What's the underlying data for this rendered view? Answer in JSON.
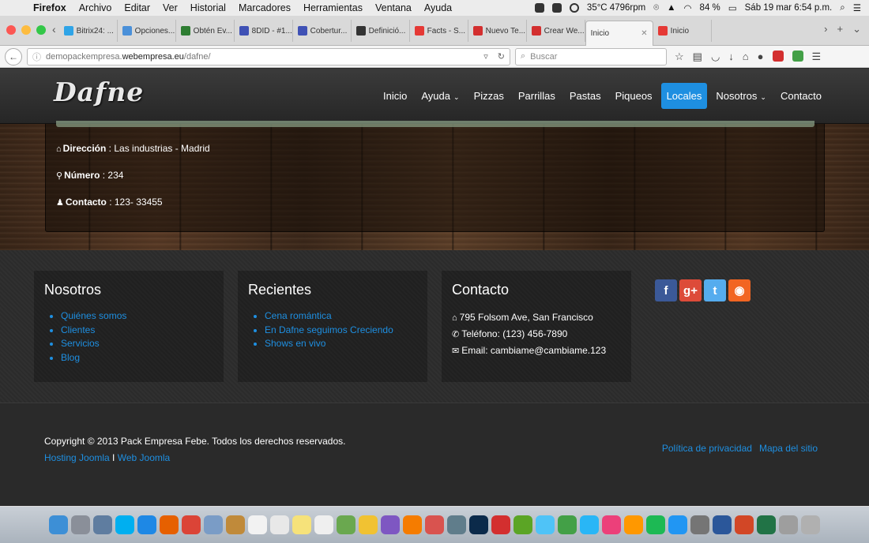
{
  "menubar": {
    "app": "Firefox",
    "items": [
      "Archivo",
      "Editar",
      "Ver",
      "Historial",
      "Marcadores",
      "Herramientas",
      "Ventana",
      "Ayuda"
    ],
    "temp": "35°C 4796rpm",
    "battery": "84 %",
    "datetime": "Sáb 19 mar  6:54 p.m."
  },
  "tabs": [
    {
      "label": "Bitrix24: ...",
      "color": "#2fa4e7"
    },
    {
      "label": "Opciones...",
      "color": "#4a90d9"
    },
    {
      "label": "Obtén Ev...",
      "color": "#2e7d32"
    },
    {
      "label": "8DID - #1...",
      "color": "#3f51b5"
    },
    {
      "label": "Cobertur...",
      "color": "#3f51b5"
    },
    {
      "label": "Definició...",
      "color": "#333333"
    },
    {
      "label": "Facts - S...",
      "color": "#e53935"
    },
    {
      "label": "Nuevo Te...",
      "color": "#d32f2f"
    },
    {
      "label": "Crear We...",
      "color": "#d32f2f"
    },
    {
      "label": "Inicio",
      "color": "#f5f5f5",
      "active": true
    },
    {
      "label": "Inicio",
      "color": "#e53935"
    }
  ],
  "navbar": {
    "url_prefix": "demopackempresa.",
    "url_host": "webempresa.eu",
    "url_path": "/dafne/",
    "search_placeholder": "Buscar"
  },
  "site": {
    "logo": "Dafne",
    "nav": [
      {
        "label": "Inicio"
      },
      {
        "label": "Ayuda",
        "caret": true
      },
      {
        "label": "Pizzas"
      },
      {
        "label": "Parrillas"
      },
      {
        "label": "Pastas"
      },
      {
        "label": "Piqueos"
      },
      {
        "label": "Locales",
        "active": true
      },
      {
        "label": "Nosotros",
        "caret": true
      },
      {
        "label": "Contacto"
      }
    ]
  },
  "location": {
    "address_label": "Dirección",
    "address_value": " : Las industrias - Madrid",
    "number_label": "Número",
    "number_value": " : 234",
    "contact_label": "Contacto",
    "contact_value": " : 123- 33455"
  },
  "footer": {
    "nosotros": {
      "title": "Nosotros",
      "links": [
        "Quiénes somos",
        "Clientes",
        "Servicios",
        "Blog"
      ]
    },
    "recientes": {
      "title": "Recientes",
      "links": [
        "Cena romántica",
        "En Dafne seguimos Creciendo",
        "Shows en vivo"
      ]
    },
    "contacto": {
      "title": "Contacto",
      "address": "795 Folsom Ave, San Francisco",
      "phone": "Teléfono: (123) 456-7890",
      "email": "Email: cambiame@cambiame.123"
    },
    "social": [
      "facebook-icon",
      "google-plus-icon",
      "twitter-icon",
      "rss-icon"
    ]
  },
  "copyright": {
    "text": "Copyright © 2013 Pack Empresa Febe. Todos los derechos reservados.",
    "link1": "Hosting Joomla",
    "sep": " I ",
    "link2": "Web Joomla",
    "privacy": "Política de privacidad",
    "sitemap": "Mapa del sitio"
  },
  "dock": [
    {
      "name": "finder-icon",
      "color": "#3d8fd6"
    },
    {
      "name": "launchpad-icon",
      "color": "#8a8f99"
    },
    {
      "name": "photos-icon",
      "color": "#5f7da0"
    },
    {
      "name": "skype-icon",
      "color": "#00aff0"
    },
    {
      "name": "safari-icon",
      "color": "#1e88e5"
    },
    {
      "name": "firefox-icon",
      "color": "#e66000"
    },
    {
      "name": "chrome-icon",
      "color": "#db4437"
    },
    {
      "name": "preview-icon",
      "color": "#7a9cc6"
    },
    {
      "name": "book-icon",
      "color": "#c08a3a"
    },
    {
      "name": "calendar-icon",
      "color": "#f2f2f2"
    },
    {
      "name": "textedit-icon",
      "color": "#e8e8e8"
    },
    {
      "name": "notes-icon",
      "color": "#f6e27a"
    },
    {
      "name": "reminders-icon",
      "color": "#efefef"
    },
    {
      "name": "image-icon",
      "color": "#6aa84f"
    },
    {
      "name": "photos-app-icon",
      "color": "#f1c232"
    },
    {
      "name": "podcast-icon",
      "color": "#7e57c2"
    },
    {
      "name": "vlc-icon",
      "color": "#f57c00"
    },
    {
      "name": "popcorn-icon",
      "color": "#d9534f"
    },
    {
      "name": "magnifier-icon",
      "color": "#607d8b"
    },
    {
      "name": "photoshop-icon",
      "color": "#0b2a4a"
    },
    {
      "name": "acrobat-icon",
      "color": "#d32f2f"
    },
    {
      "name": "evernote-icon",
      "color": "#5ba525"
    },
    {
      "name": "messages-icon",
      "color": "#4fc3f7"
    },
    {
      "name": "facetime-icon",
      "color": "#43a047"
    },
    {
      "name": "skype2-icon",
      "color": "#29b6f6"
    },
    {
      "name": "itunes-icon",
      "color": "#ec407a"
    },
    {
      "name": "ibooks-icon",
      "color": "#ff9800"
    },
    {
      "name": "spotify-icon",
      "color": "#1db954"
    },
    {
      "name": "appstore-icon",
      "color": "#2196f3"
    },
    {
      "name": "preferences-icon",
      "color": "#757575"
    },
    {
      "name": "word-icon",
      "color": "#2b579a"
    },
    {
      "name": "powerpoint-icon",
      "color": "#d24726"
    },
    {
      "name": "excel-icon",
      "color": "#217346"
    },
    {
      "name": "clipboard-icon",
      "color": "#9e9e9e"
    },
    {
      "name": "trash-icon",
      "color": "#b0b0b0"
    }
  ]
}
